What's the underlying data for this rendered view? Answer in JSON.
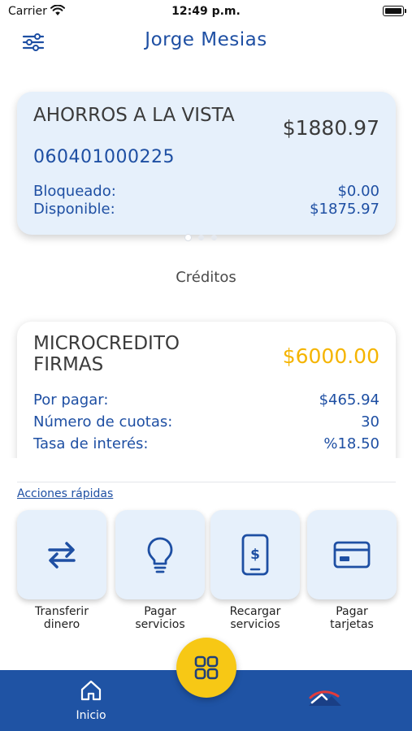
{
  "status_bar": {
    "carrier": "Carrier",
    "time": "12:49 p.m."
  },
  "header": {
    "title": "Jorge Mesias",
    "filter_icon": "sliders-icon"
  },
  "savings_card": {
    "name": "AHORROS A LA VISTA",
    "number": "060401000225",
    "balance": "$1880.97",
    "rows": [
      {
        "label": "Bloqueado:",
        "value": "$0.00"
      },
      {
        "label": "Disponible:",
        "value": "$1875.97"
      }
    ]
  },
  "carousel": {
    "count": 3,
    "active": 0
  },
  "credits": {
    "section_title": "Créditos",
    "card": {
      "name": "MICROCREDITO FIRMAS",
      "amount": "$6000.00",
      "rows": [
        {
          "label": "Por pagar:",
          "value": "$465.94"
        },
        {
          "label": "Número de cuotas:",
          "value": "30"
        },
        {
          "label": "Tasa de interés:",
          "value": "%18.50"
        }
      ]
    }
  },
  "quick_actions": {
    "title": "Acciones rápidas",
    "items": [
      {
        "line1": "Transferir",
        "line2": "dinero",
        "icon": "transfer-arrows-icon"
      },
      {
        "line1": "Pagar",
        "line2": "servicios",
        "icon": "lightbulb-icon"
      },
      {
        "line1": "Recargar",
        "line2": "servicios",
        "icon": "phone-dollar-icon"
      },
      {
        "line1": "Pagar",
        "line2": "tarjetas",
        "icon": "credit-card-icon"
      }
    ]
  },
  "bottom_nav": {
    "home_label": "Inicio",
    "home_icon": "home-icon",
    "logo_icon": "mountain-logo-icon",
    "fab_icon": "grid-icon"
  },
  "colors": {
    "primary": "#1f53a4",
    "accent_text": "#1e4fa3",
    "card_bg": "#e6f0fb",
    "fab": "#f7c815",
    "credit_amount": "#f5b400"
  }
}
